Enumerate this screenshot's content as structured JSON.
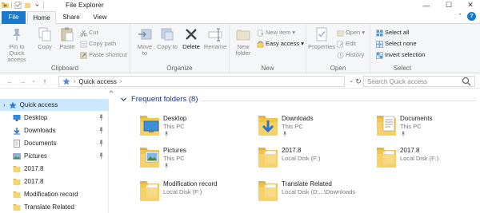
{
  "window": {
    "title": "File Explorer",
    "minimize": "—",
    "maximize": "☐",
    "close": "✕"
  },
  "tabs": {
    "file": "File",
    "home": "Home",
    "share": "Share",
    "view": "View"
  },
  "ribbon": {
    "clipboard": {
      "label": "Clipboard",
      "pin": "Pin to Quick access",
      "copy": "Copy",
      "paste": "Paste",
      "cut": "Cut",
      "copy_path": "Copy path",
      "paste_shortcut": "Paste shortcut"
    },
    "organize": {
      "label": "Organize",
      "move_to": "Move to",
      "copy_to": "Copy to",
      "delete": "Delete",
      "rename": "Rename"
    },
    "new": {
      "label": "New",
      "new_folder": "New folder",
      "new_item": "New item",
      "easy_access": "Easy access"
    },
    "open": {
      "label": "Open",
      "properties": "Properties",
      "open": "Open",
      "edit": "Edit",
      "history": "History"
    },
    "select": {
      "label": "Select",
      "select_all": "Select all",
      "select_none": "Select none",
      "invert": "Invert selection"
    }
  },
  "address": {
    "crumb": "Quick access",
    "search_placeholder": "Search Quick access"
  },
  "nav": {
    "items": [
      {
        "label": "Quick access",
        "icon": "star-icon",
        "selected": true,
        "pinned": false
      },
      {
        "label": "Desktop",
        "icon": "desktop-icon",
        "selected": false,
        "pinned": true
      },
      {
        "label": "Downloads",
        "icon": "download-icon",
        "selected": false,
        "pinned": true
      },
      {
        "label": "Documents",
        "icon": "documents-icon",
        "selected": false,
        "pinned": true
      },
      {
        "label": "Pictures",
        "icon": "pictures-icon",
        "selected": false,
        "pinned": true
      },
      {
        "label": "2017.8",
        "icon": "folder-icon",
        "selected": false,
        "pinned": false
      },
      {
        "label": "2017.8",
        "icon": "folder-icon",
        "selected": false,
        "pinned": false
      },
      {
        "label": "Modification record",
        "icon": "folder-icon",
        "selected": false,
        "pinned": false
      },
      {
        "label": "Translate Related",
        "icon": "folder-icon",
        "selected": false,
        "pinned": false
      }
    ]
  },
  "content": {
    "group_title": "Frequent folders (8)",
    "folders": [
      {
        "name": "Desktop",
        "location": "This PC",
        "icon": "desktop-folder-icon"
      },
      {
        "name": "Downloads",
        "location": "This PC",
        "icon": "downloads-folder-icon"
      },
      {
        "name": "Documents",
        "location": "This PC",
        "icon": "documents-folder-icon"
      },
      {
        "name": "Pictures",
        "location": "This PC",
        "icon": "pictures-folder-icon"
      },
      {
        "name": "2017.8",
        "location": "Local Disk (F:)",
        "icon": "folder-icon"
      },
      {
        "name": "2017.8",
        "location": "Local Disk (F:)",
        "icon": "folder-icon"
      },
      {
        "name": "Modification record",
        "location": "Local Disk (F:)",
        "icon": "folder-icon"
      },
      {
        "name": "Translate Related",
        "location": "Local Disk (D:...\\Downloads",
        "icon": "folder-icon"
      }
    ]
  },
  "colors": {
    "accent": "#1979ca",
    "folder": "#f7d26e",
    "selection": "#cce8ff"
  }
}
